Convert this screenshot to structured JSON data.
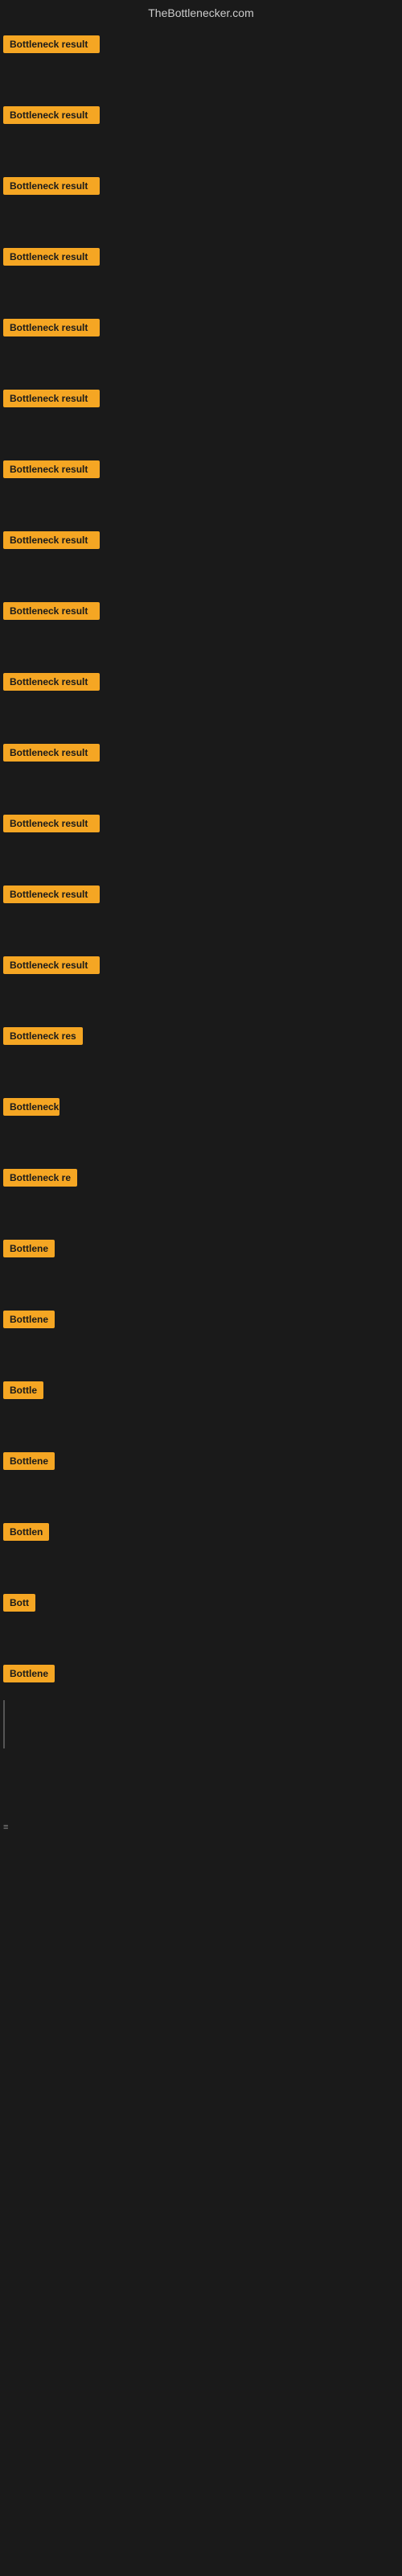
{
  "site": {
    "title": "TheBottlenecker.com"
  },
  "items": [
    {
      "id": 0,
      "label": "Bottleneck result",
      "truncated": "Bottleneck result"
    },
    {
      "id": 1,
      "label": "Bottleneck result",
      "truncated": "Bottleneck result"
    },
    {
      "id": 2,
      "label": "Bottleneck result",
      "truncated": "Bottleneck result"
    },
    {
      "id": 3,
      "label": "Bottleneck result",
      "truncated": "Bottleneck result"
    },
    {
      "id": 4,
      "label": "Bottleneck result",
      "truncated": "Bottleneck result"
    },
    {
      "id": 5,
      "label": "Bottleneck result",
      "truncated": "Bottleneck result"
    },
    {
      "id": 6,
      "label": "Bottleneck result",
      "truncated": "Bottleneck result"
    },
    {
      "id": 7,
      "label": "Bottleneck result",
      "truncated": "Bottleneck result"
    },
    {
      "id": 8,
      "label": "Bottleneck result",
      "truncated": "Bottleneck result"
    },
    {
      "id": 9,
      "label": "Bottleneck result",
      "truncated": "Bottleneck result"
    },
    {
      "id": 10,
      "label": "Bottleneck result",
      "truncated": "Bottleneck result"
    },
    {
      "id": 11,
      "label": "Bottleneck result",
      "truncated": "Bottleneck result"
    },
    {
      "id": 12,
      "label": "Bottleneck result",
      "truncated": "Bottleneck result"
    },
    {
      "id": 13,
      "label": "Bottleneck result",
      "truncated": "Bottleneck result"
    },
    {
      "id": 14,
      "label": "Bottleneck result",
      "truncated": "Bottleneck res"
    },
    {
      "id": 15,
      "label": "Bottleneck",
      "truncated": "Bottleneck"
    },
    {
      "id": 16,
      "label": "Bottleneck result",
      "truncated": "Bottleneck re"
    },
    {
      "id": 17,
      "label": "Bottleneck",
      "truncated": "Bottlene"
    },
    {
      "id": 18,
      "label": "Bottleneck",
      "truncated": "Bottlene"
    },
    {
      "id": 19,
      "label": "Bottle",
      "truncated": "Bottle"
    },
    {
      "id": 20,
      "label": "Bottleneck",
      "truncated": "Bottlene"
    },
    {
      "id": 21,
      "label": "Bottlen",
      "truncated": "Bottlen"
    },
    {
      "id": 22,
      "label": "Bott",
      "truncated": "Bott"
    },
    {
      "id": 23,
      "label": "Bottleneck",
      "truncated": "Bottlene"
    }
  ],
  "small_char": "≡",
  "colors": {
    "badge_bg": "#f5a623",
    "bg": "#1a1a1a",
    "title": "#cccccc"
  }
}
